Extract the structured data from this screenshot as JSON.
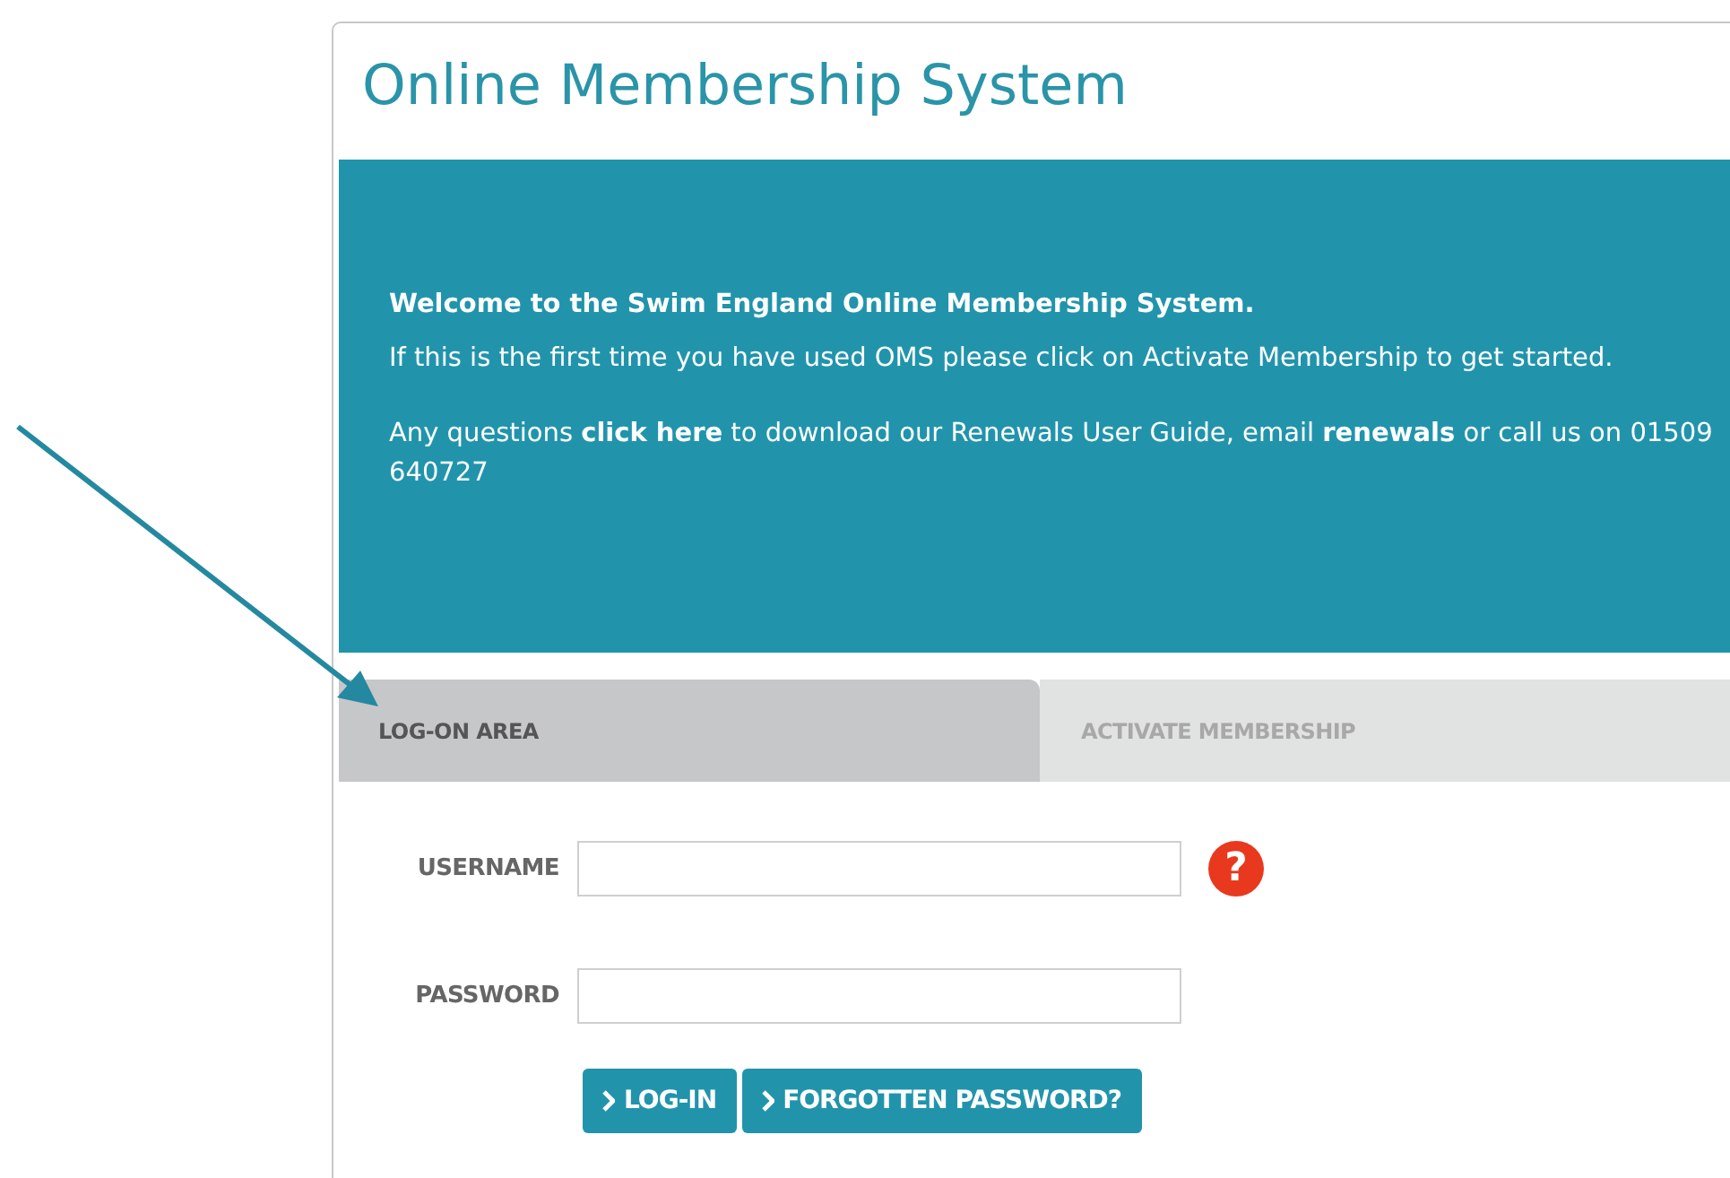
{
  "title": "Online Membership System",
  "banner": {
    "heading": "Welcome to the Swim England Online Membership System.",
    "intro": "If this is the first time you have used OMS please click on Activate Membership to get started.",
    "contact": [
      {
        "kind": "text",
        "text": "Any questions "
      },
      {
        "kind": "link",
        "text": "click here"
      },
      {
        "kind": "text",
        "text": " to download our Renewals User Guide, email "
      },
      {
        "kind": "link",
        "text": "renewals"
      },
      {
        "kind": "text",
        "text": " or call us on 01509 640727"
      }
    ]
  },
  "tabs": [
    {
      "label": "LOG-ON AREA",
      "selected": true
    },
    {
      "label": "ACTIVATE MEMBERSHIP",
      "selected": false
    }
  ],
  "fields": [
    {
      "label": "USERNAME",
      "help": "?"
    },
    {
      "label": "PASSWORD"
    }
  ],
  "buttons": [
    "LOG-IN",
    "FORGOTTEN PASSWORD?"
  ]
}
